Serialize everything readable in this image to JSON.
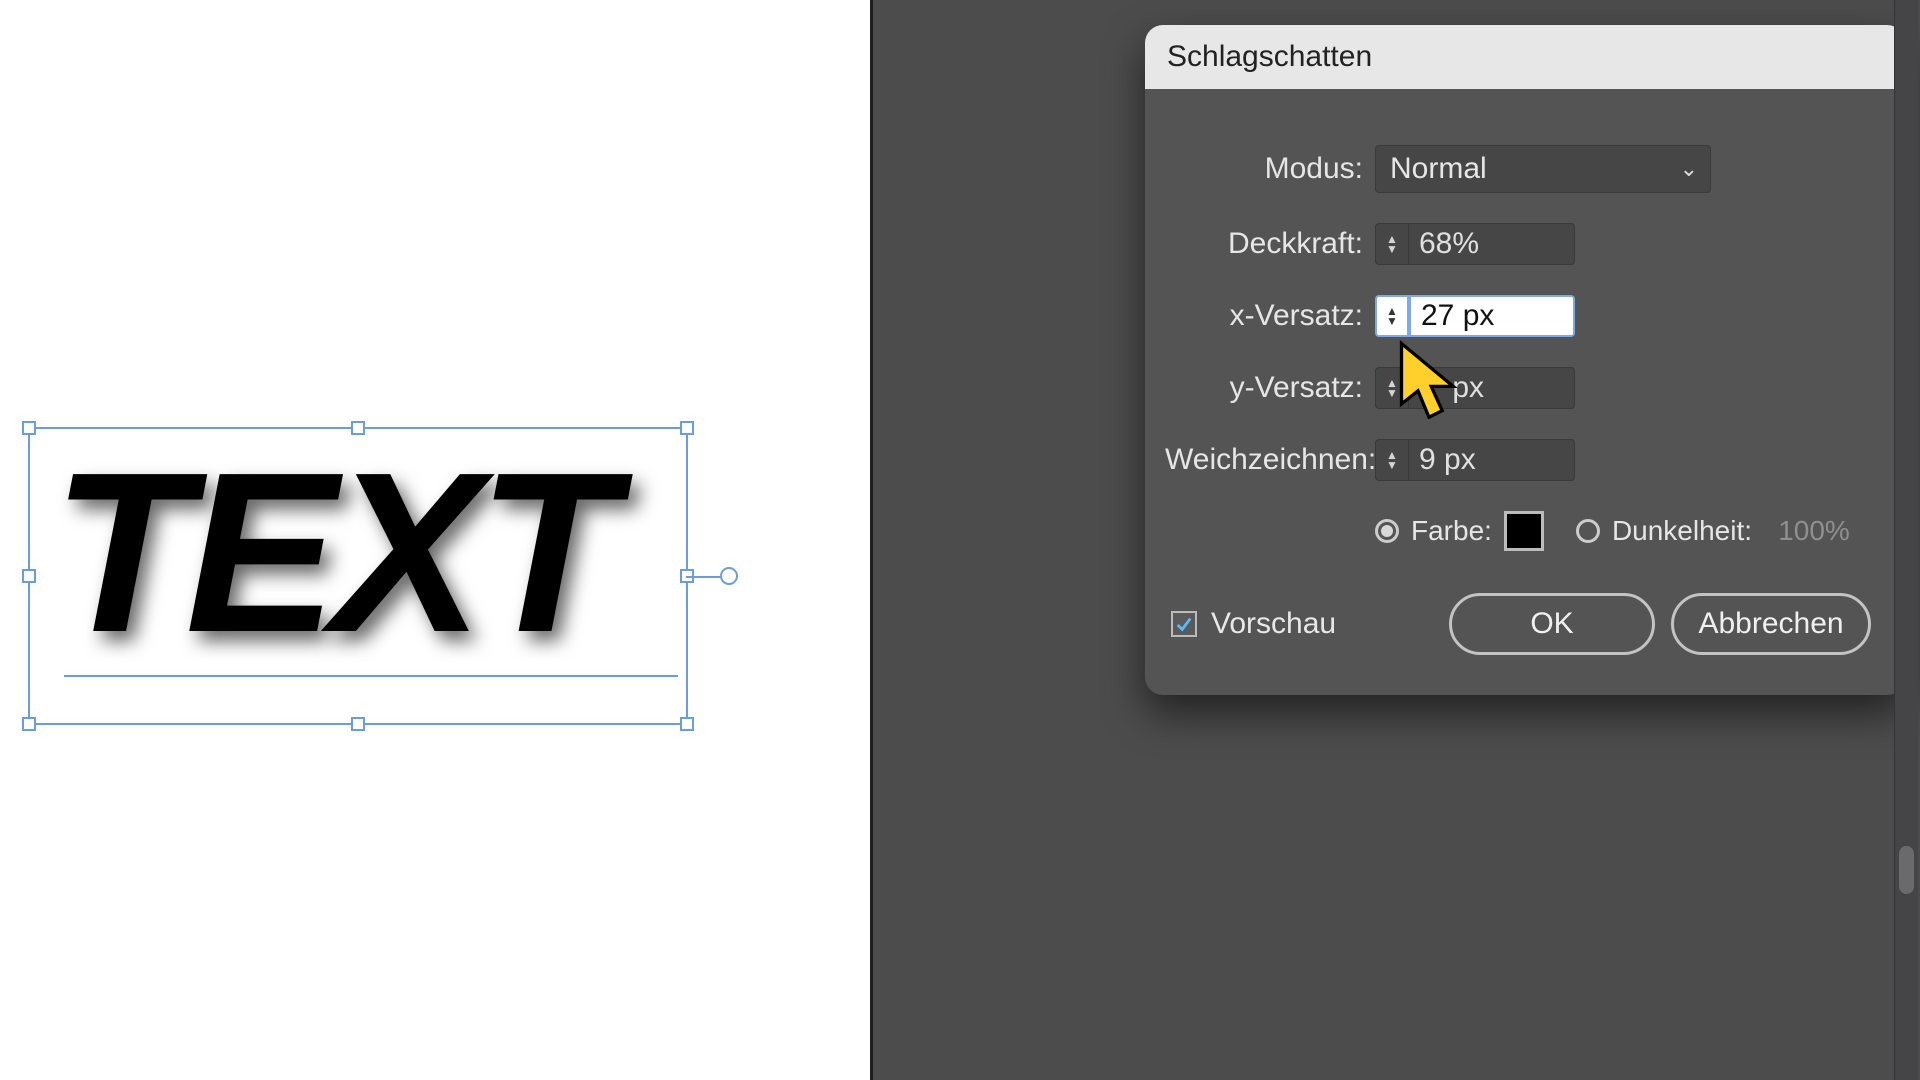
{
  "canvas": {
    "text_content": "TEXT"
  },
  "dialog": {
    "title": "Schlagschatten",
    "mode_label": "Modus:",
    "mode_value": "Normal",
    "opacity_label": "Deckkraft:",
    "opacity_value": "68%",
    "x_offset_label": "x-Versatz:",
    "x_offset_value": "27 px",
    "y_offset_label": "y-Versatz:",
    "y_offset_value_suffix": "px",
    "blur_label": "Weichzeichnen:",
    "blur_value": "9 px",
    "color_label": "Farbe:",
    "color_value": "#000000",
    "darkness_label": "Dunkelheit:",
    "darkness_value": "100%",
    "preview_label": "Vorschau",
    "ok_label": "OK",
    "cancel_label": "Abbrechen"
  }
}
